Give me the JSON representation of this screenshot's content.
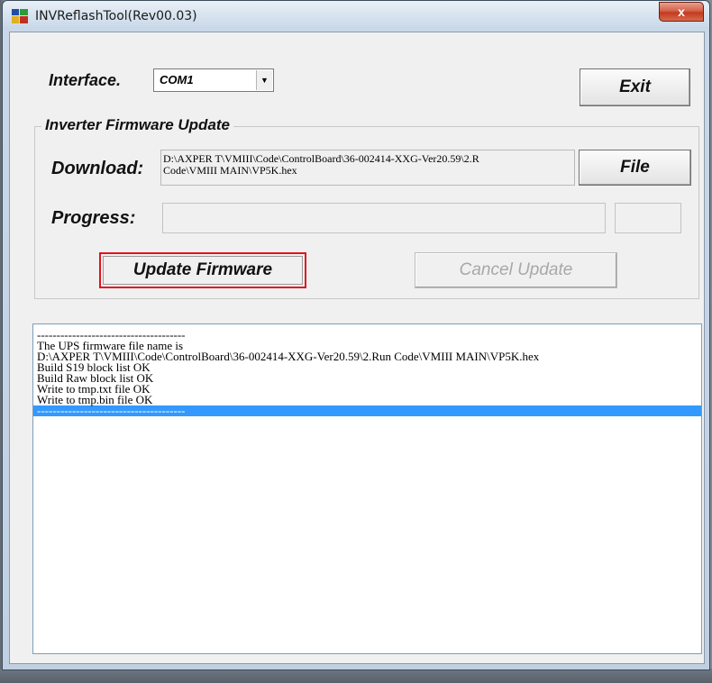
{
  "window": {
    "title": "INVReflashTool(Rev00.03)",
    "close_label": "x"
  },
  "interface": {
    "label": "Interface.",
    "selected": "COM1"
  },
  "exit_label": "Exit",
  "firmware_group": {
    "title": "Inverter Firmware Update",
    "download_label": "Download:",
    "path_lines": [
      "D:\\AXPER T\\VMIII\\Code\\ControlBoard\\36-002414-XXG-Ver20.59\\2.R",
      "Code\\VMIII MAIN\\VP5K.hex"
    ],
    "file_label": "File",
    "progress_label": "Progress:",
    "progress_value": 0,
    "update_label": "Update Firmware",
    "cancel_label": "Cancel Update"
  },
  "log": {
    "lines": [
      "--------------------------------------",
      "The UPS firmware file name is",
      "D:\\AXPER T\\VMIII\\Code\\ControlBoard\\36-002414-XXG-Ver20.59\\2.Run Code\\VMIII MAIN\\VP5K.hex",
      "Build S19 block list OK",
      "Build Raw block list OK",
      "Write to tmp.txt file OK",
      "Write to tmp.bin file OK",
      "--------------------------------------"
    ],
    "selected_index": 7
  },
  "colors": {
    "highlight_border": "#e0141e",
    "selection": "#3399ff",
    "close_button": "#c33a1f"
  }
}
